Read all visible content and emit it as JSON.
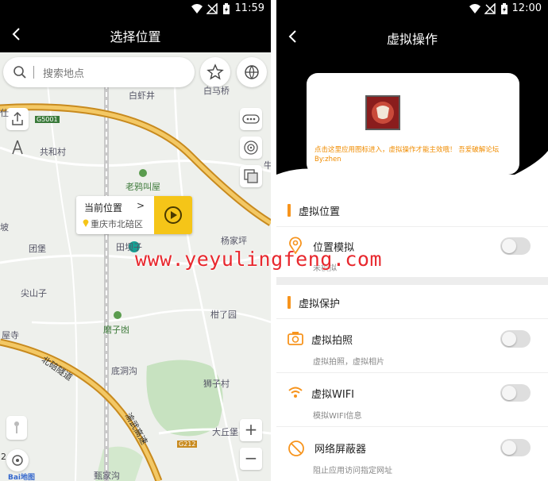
{
  "left": {
    "status_time": "11:59",
    "title": "选择位置",
    "search_placeholder": "搜索地点",
    "popup": {
      "title": "当前位置",
      "chevron": ">",
      "address": "重庆市北碚区"
    },
    "map_labels": {
      "baixiajing": "白虾井",
      "baimaqiao": "白马桥",
      "g5001": "G5001",
      "gongheucun": "共和村",
      "laoyajiaowu": "老鸦叫屋",
      "tuanbao": "团堡",
      "tianba": "田坝子",
      "yangjiaping": "杨家坪",
      "jianshanzi": "尖山子",
      "mozitan": "磨子凼",
      "ganliaoyuan": "柑了园",
      "pusi": "屋寺",
      "beibei_tunnel": "北碚隧道",
      "didonggou": "底洞沟",
      "shizicun": "狮子村",
      "expressway": "渝武高速",
      "daqiubao": "大丘堡",
      "g212": "G212",
      "gujiagou": "甄家沟",
      "bo": "坡",
      "shi": "仕",
      "niu": "牛"
    },
    "zoom_in": "+",
    "zoom_out": "−",
    "map_logo": "Bai地图",
    "scale_digit": "2"
  },
  "right": {
    "status_time": "12:00",
    "title": "虚拟操作",
    "card_text": "点击这里应用图标进入，虚拟操作才能主效哦！ 吾爱破解论坛 By:zhen",
    "sections": {
      "location": "虚拟位置",
      "protect": "虚拟保护"
    },
    "rows": {
      "location_sim": {
        "name": "位置模拟",
        "sub": "未模拟"
      },
      "photo": {
        "name": "虚拟拍照",
        "sub": "虚拟拍照，虚拟相片"
      },
      "wifi": {
        "name": "虚拟WIFI",
        "sub": "模拟WIFI信息"
      },
      "shield": {
        "name": "网络屏蔽器",
        "sub": "阻止应用访问指定网址"
      }
    }
  },
  "watermark": "www.yeyulingfeng.com",
  "colors": {
    "accent_orange": "#f7941d",
    "play_yellow": "#f5c518",
    "watermark_red": "#e8282e",
    "road_orange": "#d9a441"
  }
}
